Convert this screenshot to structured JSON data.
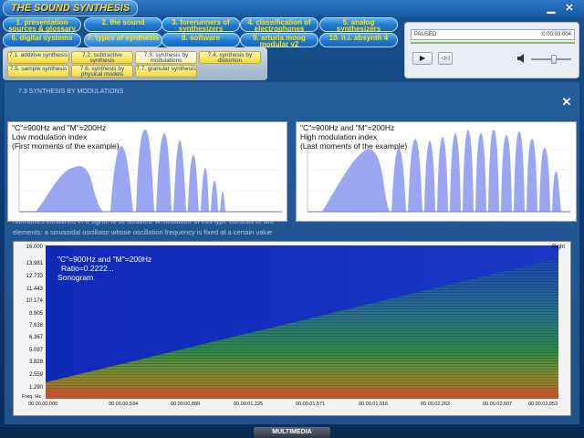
{
  "app": {
    "title": "THE SOUND SYNTHESIS",
    "minimize": "▁",
    "close": "✕"
  },
  "menu": [
    {
      "label": "1. presentation sources & glossary"
    },
    {
      "label": "2. the sound"
    },
    {
      "label": "3. forerunners of synthesizers"
    },
    {
      "label": "4. classification of electrophones"
    },
    {
      "label": "5. analog synthesizers"
    },
    {
      "label": "6. digital systems"
    },
    {
      "label": "7. types of synthesis",
      "active": true
    },
    {
      "label": "8. software"
    },
    {
      "label": "9. arturia moog modular v2"
    },
    {
      "label": "10. n.i. absynth 4"
    }
  ],
  "submenu": [
    {
      "label": "7.1. additive synthesis"
    },
    {
      "label": "7.2. subtractive synthesis"
    },
    {
      "label": "7.3. synthesis by modulations",
      "active": true
    },
    {
      "label": "7.4. synthesis by distortion"
    },
    {
      "label": "7.5. sample synthesis"
    },
    {
      "label": "7.6. synthesis by physical models"
    },
    {
      "label": "7.7. granular synthesis"
    }
  ],
  "player": {
    "status": "PAUSED",
    "time": "0:00:03.004",
    "play": "▶",
    "rewind": "◁◁",
    "volume_icon": "speaker-icon"
  },
  "background": {
    "heading": "7.3 SYNTHESIS BY MODULATIONS",
    "text1": "harmonics contained in a signal to be doubled. A modulator of this type consists of two",
    "text2": "elements: a sinusoidal oscillator whose oscillation frequency is fixed at a certain value"
  },
  "overlay": {
    "close": "✕",
    "wave_left": {
      "line1": "\"C\"=900Hz and \"M\"=200Hz",
      "line2": "Low modulation index",
      "line3": "(First moments of the example)"
    },
    "wave_right": {
      "line1": "\"C\"=900Hz and \"M\"=200Hz",
      "line2": "High modulation index",
      "line3": "(Last moments of the example)"
    },
    "sonogram": {
      "line1": "\"C\"=900Hz and \"M\"=200Hz",
      "line2": "Ratio=0.2222...",
      "line3": "Sonogram",
      "channel": "Right",
      "freq_label": "Freq. Hz",
      "yticks": [
        "16.000",
        "13.981",
        "12.733",
        "11.443",
        "10.174",
        "8.905",
        "7.636",
        "6.367",
        "5.097",
        "3.828",
        "2.559",
        "1.290"
      ],
      "xticks": [
        "00.00.00,000",
        "00.00.00,534",
        "00.00.00,880",
        "00.00.01,225",
        "00.00.01,571",
        "00.00.01,916",
        "00.00.02,262",
        "00.00.02,607",
        "00.00.02,953"
      ]
    }
  },
  "footer": {
    "label": "MULTIMEDIA"
  },
  "colors": {
    "accent_yellow": "#ffe600",
    "button_blue": "#1f78d0",
    "wave_fill": "#9aa6f2",
    "sono_bg": "#1a2fb0"
  }
}
